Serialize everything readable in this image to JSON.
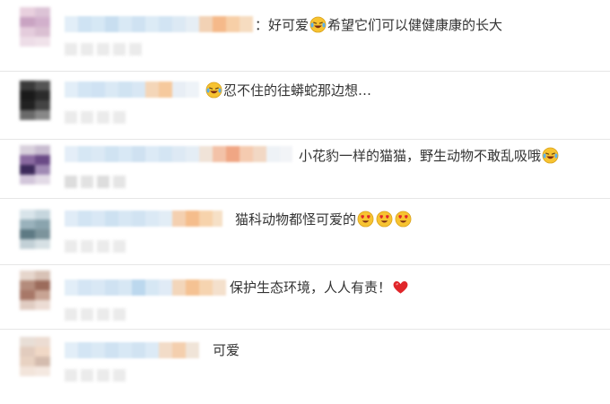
{
  "comments": [
    {
      "parts": [
        {
          "type": "text",
          "value": "："
        },
        {
          "type": "text",
          "value": "好可爱"
        },
        {
          "type": "icon",
          "icon": "laughing-crying-emoji"
        },
        {
          "type": "text",
          "value": "希望它们可以健健康康的长大"
        }
      ]
    },
    {
      "parts": [
        {
          "type": "icon",
          "icon": "laughing-crying-emoji"
        },
        {
          "type": "text",
          "value": "忍不住的往蟒蛇那边想…"
        }
      ]
    },
    {
      "parts": [
        {
          "type": "text",
          "value": "小花豹一样的猫猫，野生动物不敢乱吸哦"
        },
        {
          "type": "icon",
          "icon": "laughing-crying-emoji"
        }
      ]
    },
    {
      "parts": [
        {
          "type": "text",
          "value": "猫科动物都怪可爱的"
        },
        {
          "type": "icon",
          "icon": "heart-eyes-emoji"
        },
        {
          "type": "icon",
          "icon": "heart-eyes-emoji"
        },
        {
          "type": "icon",
          "icon": "heart-eyes-emoji"
        }
      ]
    },
    {
      "parts": [
        {
          "type": "text",
          "value": "保护生态环境，人人有责！"
        },
        {
          "type": "icon",
          "icon": "red-heart-emoji"
        }
      ]
    },
    {
      "parts": [
        {
          "type": "text",
          "value": "可爱"
        }
      ]
    }
  ],
  "colors": {
    "text": "#333333",
    "divider": "#e6e6e6",
    "nickname_blur": "#d6e6f2",
    "emoji_yellow": "#f7c331",
    "heart_red": "#e0262a"
  }
}
